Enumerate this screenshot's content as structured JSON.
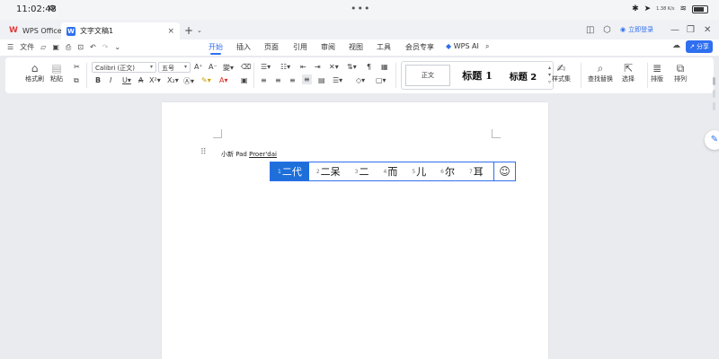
{
  "status_bar": {
    "time": "11:02:48",
    "network_speed": "1.38 K/s",
    "battery_level": 0.8
  },
  "tabs": {
    "app_tab": "WPS Office",
    "doc_tab": "文字文稿1"
  },
  "header": {
    "share_top_label": "立即登录"
  },
  "menu": {
    "file_label": "文件",
    "tabs": [
      "开始",
      "插入",
      "页面",
      "引用",
      "审阅",
      "视图",
      "工具",
      "会员专享"
    ],
    "active_tab": "开始",
    "ai_label": "WPS AI",
    "share_label": "分享"
  },
  "ribbon": {
    "format_painter": "格式刷",
    "paste": "粘贴",
    "font_name": "Calibri (正文)",
    "font_size": "五号",
    "style_normal": "正文",
    "style_h1": "标题 1",
    "style_h2": "标题 2",
    "style_set": "样式集",
    "find_replace": "查找替换",
    "select": "选择",
    "layout": "排版",
    "arrange": "排列"
  },
  "document": {
    "typed_text": "小新 Pad ",
    "composing_text": "Proer'dai"
  },
  "ime": {
    "candidates": [
      {
        "num": "1",
        "text": "二代"
      },
      {
        "num": "2",
        "text": "二呆"
      },
      {
        "num": "3",
        "text": "二"
      },
      {
        "num": "4",
        "text": "而"
      },
      {
        "num": "5",
        "text": "儿"
      },
      {
        "num": "6",
        "text": "尔"
      },
      {
        "num": "7",
        "text": "耳"
      }
    ],
    "selected_index": 0
  },
  "colors": {
    "accent": "#2f6ff0",
    "ime_selected": "#1e6fd9",
    "wps_red": "#e23b3b"
  }
}
